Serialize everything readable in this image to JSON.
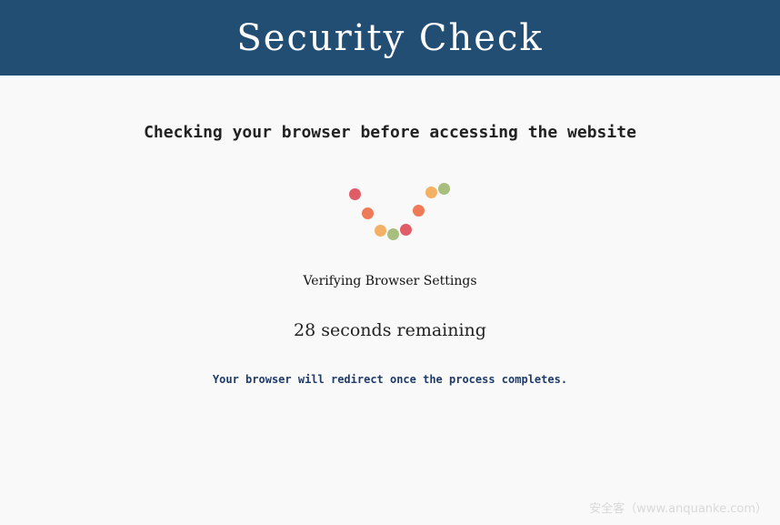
{
  "header": {
    "title": "Security Check"
  },
  "main": {
    "subtitle": "Checking your browser before accessing the website",
    "status": "Verifying Browser Settings",
    "countdown": "28 seconds remaining",
    "redirect_note": "Your browser will redirect once the process completes."
  },
  "spinner": {
    "icon": "loading-dots-icon",
    "colors": [
      "#e05c66",
      "#ee7a57",
      "#f4b165",
      "#a7be7e",
      "#e05c66",
      "#ee7a57",
      "#f4b165",
      "#a7be7e"
    ]
  },
  "watermark": {
    "text": "安全客（www.anquanke.com）"
  }
}
